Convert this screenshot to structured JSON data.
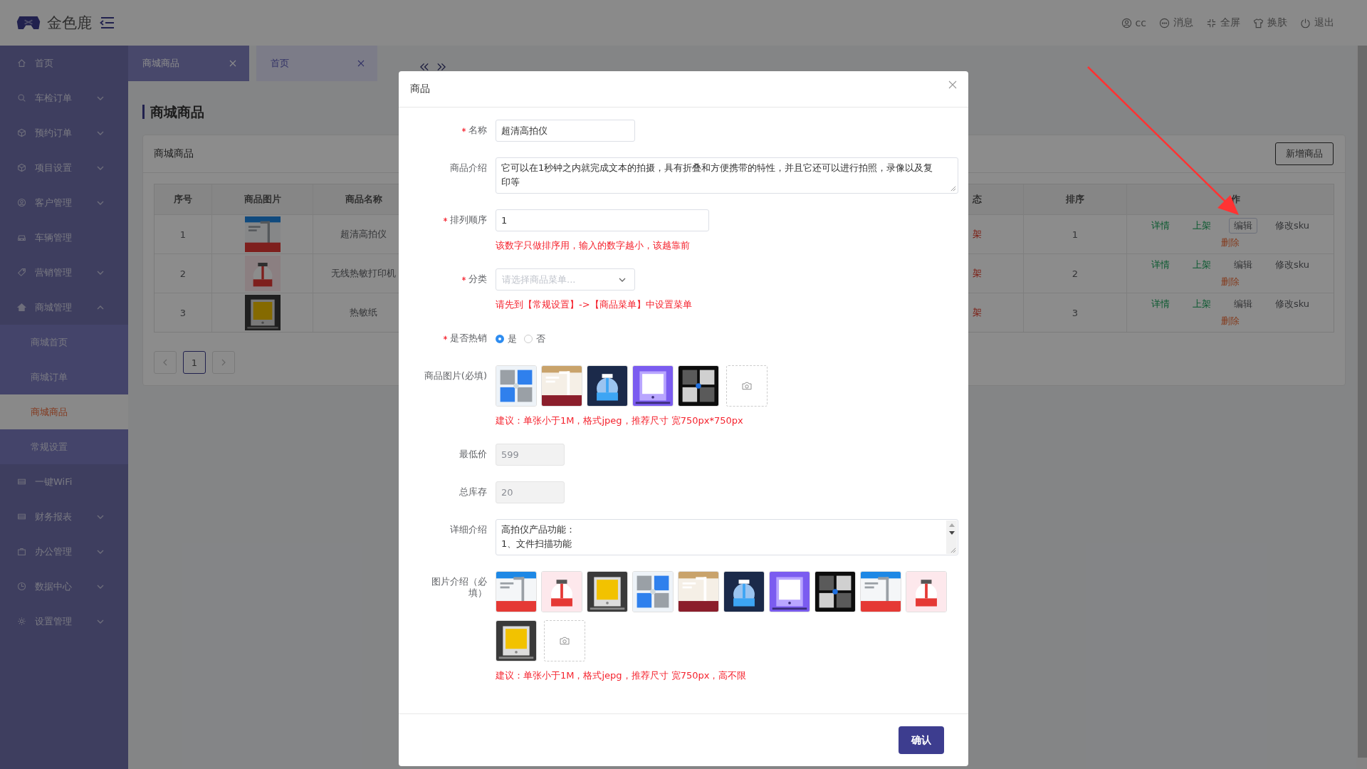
{
  "header": {
    "brand": "金色鹿",
    "actions": [
      {
        "label": "cc"
      },
      {
        "label": "消息"
      },
      {
        "label": "全屏"
      },
      {
        "label": "换肤"
      },
      {
        "label": "退出"
      }
    ]
  },
  "sidebar": {
    "items": [
      {
        "label": "首页",
        "kind": "link"
      },
      {
        "label": "车检订单",
        "kind": "group",
        "expanded": false
      },
      {
        "label": "预约订单",
        "kind": "group",
        "expanded": false
      },
      {
        "label": "项目设置",
        "kind": "group",
        "expanded": false
      },
      {
        "label": "客户管理",
        "kind": "group",
        "expanded": false
      },
      {
        "label": "车辆管理",
        "kind": "link"
      },
      {
        "label": "营销管理",
        "kind": "group",
        "expanded": false
      },
      {
        "label": "商城管理",
        "kind": "group",
        "expanded": true,
        "children": [
          {
            "label": "商城首页",
            "selected": false
          },
          {
            "label": "商城订单",
            "selected": false
          },
          {
            "label": "商城商品",
            "selected": true
          },
          {
            "label": "常规设置",
            "selected": false
          }
        ]
      },
      {
        "label": "一键WiFi",
        "kind": "link"
      },
      {
        "label": "财务报表",
        "kind": "group",
        "expanded": false
      },
      {
        "label": "办公管理",
        "kind": "group",
        "expanded": false
      },
      {
        "label": "数据中心",
        "kind": "group",
        "expanded": false
      },
      {
        "label": "设置管理",
        "kind": "group",
        "expanded": false
      }
    ]
  },
  "tabs": [
    {
      "label": "商城商品",
      "selected": true
    },
    {
      "label": "首页",
      "selected": false
    }
  ],
  "page": {
    "title": "商城商品",
    "card_title": "商城商品",
    "add_button": "新增商品"
  },
  "table": {
    "columns": [
      "序号",
      "商品图片",
      "商品名称",
      "态",
      "排序",
      "作"
    ],
    "rows": [
      {
        "seq": "1",
        "image": {
          "kind": "picture"
        },
        "name": "超清高拍仪",
        "status": "架",
        "sort": "1",
        "actions": [
          {
            "label": "详情",
            "kind": "detail",
            "focused": false
          },
          {
            "label": "上架",
            "kind": "publish",
            "focused": false
          },
          {
            "label": "编辑",
            "kind": "edit",
            "focused": true
          },
          {
            "label": "修改sku",
            "kind": "sku",
            "focused": false
          },
          {
            "label": "删除",
            "kind": "delete",
            "focused": false
          }
        ]
      },
      {
        "seq": "2",
        "image": {
          "kind": "picture"
        },
        "name": "无线热敏打印机",
        "status": "架",
        "sort": "2",
        "actions": [
          {
            "label": "详情",
            "kind": "detail",
            "focused": false
          },
          {
            "label": "上架",
            "kind": "publish",
            "focused": false
          },
          {
            "label": "编辑",
            "kind": "edit",
            "focused": false
          },
          {
            "label": "修改sku",
            "kind": "sku",
            "focused": false
          },
          {
            "label": "删除",
            "kind": "delete",
            "focused": false
          }
        ]
      },
      {
        "seq": "3",
        "image": {
          "kind": "picture"
        },
        "name": "热敏纸",
        "status": "架",
        "sort": "3",
        "actions": [
          {
            "label": "详情",
            "kind": "detail",
            "focused": false
          },
          {
            "label": "上架",
            "kind": "publish",
            "focused": false
          },
          {
            "label": "编辑",
            "kind": "edit",
            "focused": false
          },
          {
            "label": "修改sku",
            "kind": "sku",
            "focused": false
          },
          {
            "label": "删除",
            "kind": "delete",
            "focused": false
          }
        ]
      }
    ]
  },
  "pagination": {
    "pages": [
      {
        "label": "1",
        "selected": true
      }
    ]
  },
  "dialog": {
    "title": "商品",
    "confirm": "确认",
    "fields": [
      {
        "kind": "input",
        "label": "名称",
        "required": true,
        "value": "超清高拍仪",
        "disabled": false
      },
      {
        "kind": "textarea",
        "label": "商品介绍",
        "required": false,
        "value": "它可以在1秒钟之内就完成文本的拍摄，具有折叠和方便携带的特性，并且它还可以进行拍照，录像以及复印等",
        "scrollable": false
      },
      {
        "kind": "input",
        "label": "排列顺序",
        "required": true,
        "value": "1",
        "disabled": false,
        "hint": "该数字只做排序用，输入的数字越小，该越靠前"
      },
      {
        "kind": "select",
        "label": "分类",
        "required": true,
        "placeholder": "请选择商品菜单...",
        "hint": "请先到【常规设置】->【商品菜单】中设置菜单"
      },
      {
        "kind": "radio",
        "label": "是否热销",
        "required": true,
        "options": [
          {
            "label": "是",
            "selected": true
          },
          {
            "label": "否",
            "selected": false
          }
        ]
      },
      {
        "kind": "images",
        "label": "商品图片(必填)",
        "required": false,
        "images": [
          {
            "kind": "picture"
          },
          {
            "kind": "picture"
          },
          {
            "kind": "picture"
          },
          {
            "kind": "picture"
          },
          {
            "kind": "picture"
          }
        ],
        "hint": "建议：单张小于1M，格式jpeg，推荐尺寸 宽750px*750px"
      },
      {
        "kind": "input",
        "label": "最低价",
        "required": false,
        "value": "599",
        "disabled": true
      },
      {
        "kind": "input",
        "label": "总库存",
        "required": false,
        "value": "20",
        "disabled": true
      },
      {
        "kind": "textarea",
        "label": "详细介绍",
        "required": false,
        "value": "高拍仪产品功能：\n1、文件扫描功能",
        "scrollable": true
      },
      {
        "kind": "images",
        "label": "图片介绍（必填）",
        "required": false,
        "images": [
          {
            "kind": "picture"
          },
          {
            "kind": "picture"
          },
          {
            "kind": "picture"
          },
          {
            "kind": "picture"
          },
          {
            "kind": "picture"
          },
          {
            "kind": "picture"
          },
          {
            "kind": "picture"
          },
          {
            "kind": "picture"
          },
          {
            "kind": "picture"
          },
          {
            "kind": "picture"
          },
          {
            "kind": "picture"
          }
        ],
        "hint": "建议：单张小于1M，格式jepg，推荐尺寸 宽750px，高不限"
      }
    ]
  }
}
